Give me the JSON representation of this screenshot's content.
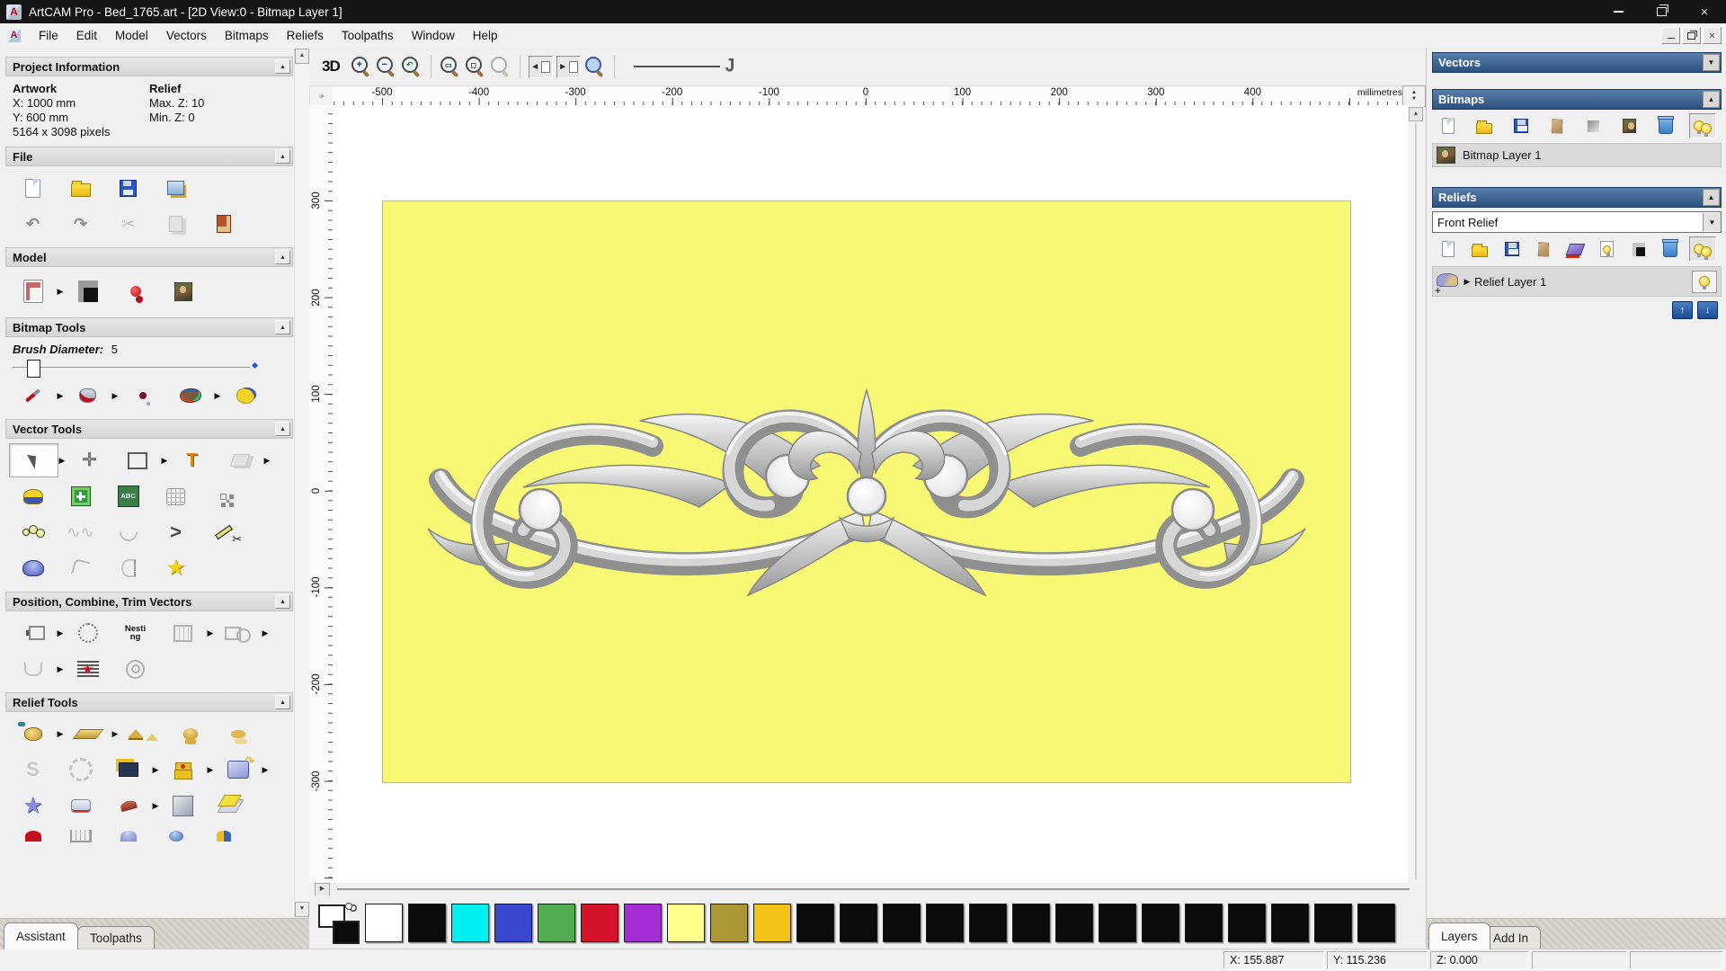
{
  "window": {
    "title": "ArtCAM Pro - Bed_1765.art - [2D View:0 - Bitmap Layer 1]"
  },
  "menu": {
    "items": [
      "File",
      "Edit",
      "Model",
      "Vectors",
      "Bitmaps",
      "Reliefs",
      "Toolpaths",
      "Window",
      "Help"
    ]
  },
  "icons": {
    "d3": "3D",
    "t": "T",
    "abc": "ABC",
    "s": "S",
    "nesting": "Nesting"
  },
  "assistant": {
    "project_information": {
      "title": "Project Information",
      "artwork_label": "Artwork",
      "x": "X: 1000 mm",
      "y": "Y: 600 mm",
      "pixels": "5164 x 3098 pixels",
      "relief_label": "Relief",
      "max_z": "Max. Z: 10",
      "min_z": "Min. Z: 0"
    },
    "sections": {
      "file": "File",
      "model": "Model",
      "bitmap_tools": "Bitmap Tools",
      "vector_tools": "Vector Tools",
      "position": "Position, Combine, Trim Vectors",
      "relief_tools": "Relief Tools"
    },
    "brush_label": "Brush Diameter:",
    "brush_value": "5",
    "tabs": [
      {
        "label": "Assistant",
        "active": true
      },
      {
        "label": "Toolpaths",
        "active": false
      }
    ]
  },
  "ruler": {
    "h_labels": [
      "-500",
      "-400",
      "-300",
      "-200",
      "-100",
      "0",
      "100",
      "200",
      "300",
      "400"
    ],
    "v_labels": [
      "300",
      "200",
      "100",
      "0",
      "-100",
      "-200",
      "-300"
    ],
    "units": "millimetres"
  },
  "right_panel": {
    "vectors_title": "Vectors",
    "bitmaps_title": "Bitmaps",
    "reliefs_title": "Reliefs",
    "bitmap_layer": "Bitmap Layer 1",
    "relief_dropdown": "Front Relief",
    "relief_layer": "Relief Layer 1",
    "tabs": [
      {
        "label": "Layers",
        "active": true
      },
      {
        "label": "Add In",
        "active": false
      }
    ]
  },
  "palette": {
    "colors": [
      "#ffffff",
      "#0b0b0b",
      "#00f0f0",
      "#3a47cf",
      "#52ad52",
      "#d41229",
      "#a42cd4",
      "#ffff8c",
      "#ab9733",
      "#f2c316",
      "#0b0b0b",
      "#0b0b0b",
      "#0b0b0b",
      "#0b0b0b",
      "#0b0b0b",
      "#0b0b0b",
      "#0b0b0b",
      "#0b0b0b",
      "#0b0b0b",
      "#0b0b0b",
      "#0b0b0b",
      "#0b0b0b",
      "#0b0b0b",
      "#0b0b0b"
    ]
  },
  "status_bar": {
    "x": "X: 155.887",
    "y": "Y: 115.236",
    "z": "Z: 0.000"
  },
  "colors": {
    "header_blue": "#2d507f",
    "canvas_yellow": "#f7f873",
    "selection_gray": "#dadada"
  }
}
